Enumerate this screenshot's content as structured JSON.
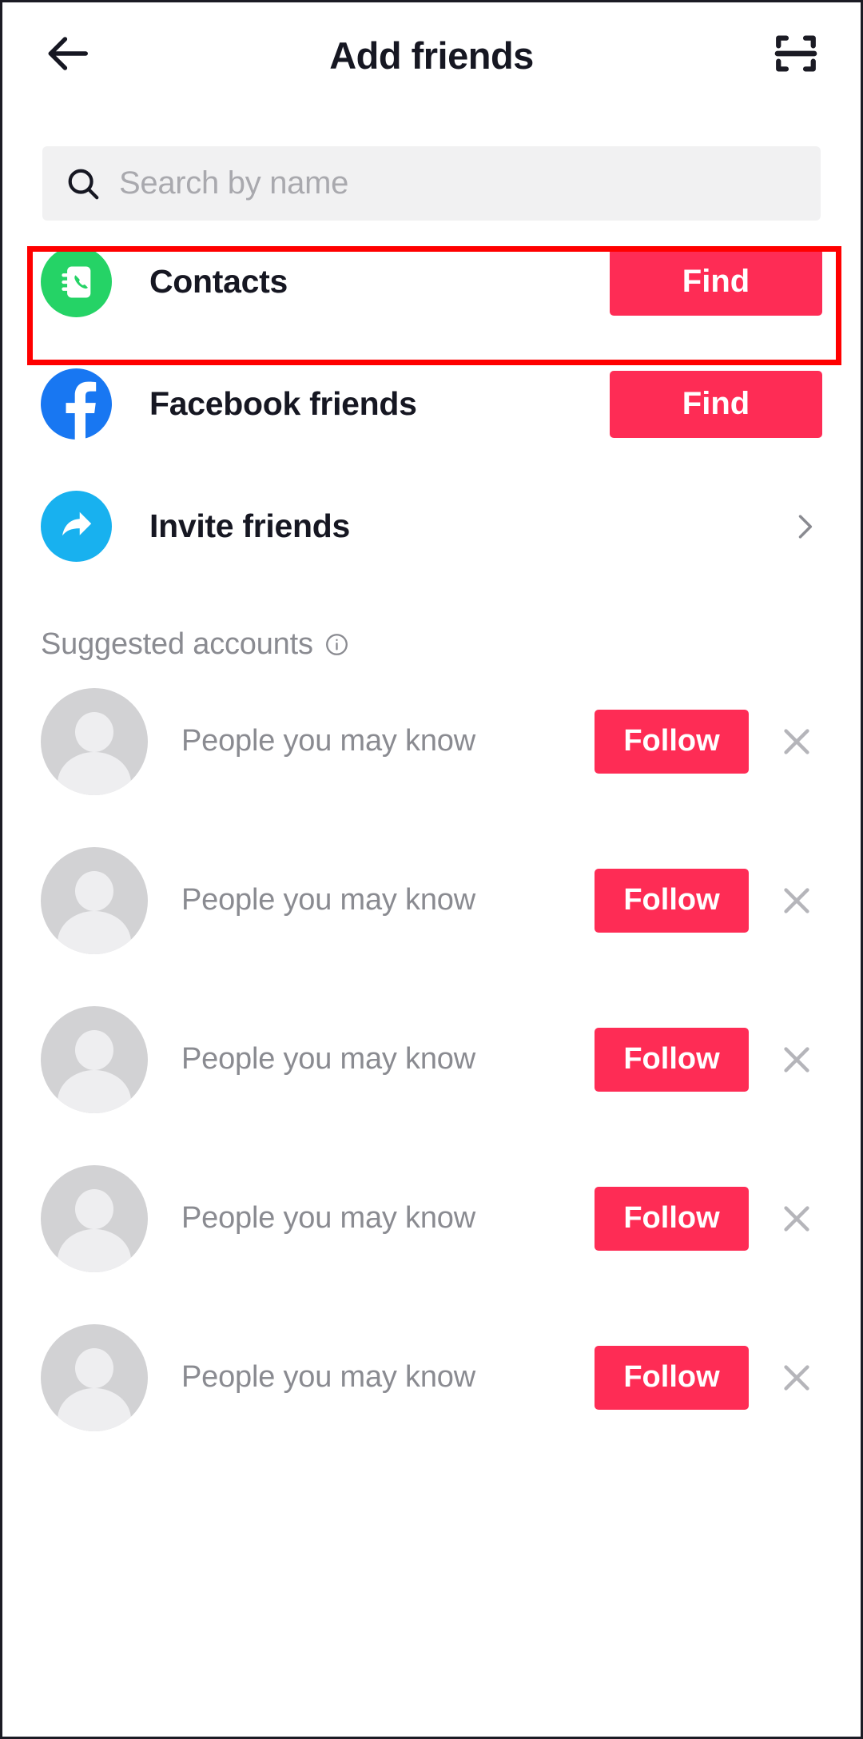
{
  "header": {
    "back_icon": "arrow-left-icon",
    "title": "Add friends",
    "scan_icon": "qr-scan-icon"
  },
  "search": {
    "icon": "search-icon",
    "placeholder": "Search by name",
    "value": ""
  },
  "sources": [
    {
      "id": "contacts",
      "label": "Contacts",
      "icon": "contacts-book-phone-icon",
      "icon_bg": "#25d366",
      "action_type": "button",
      "action_label": "Find",
      "highlighted": true
    },
    {
      "id": "facebook",
      "label": "Facebook friends",
      "icon": "facebook-icon",
      "icon_bg": "#1877f2",
      "action_type": "button",
      "action_label": "Find",
      "highlighted": false
    },
    {
      "id": "invite",
      "label": "Invite friends",
      "icon": "share-arrow-icon",
      "icon_bg": "#18b1ef",
      "action_type": "chevron",
      "action_label": "",
      "highlighted": false
    }
  ],
  "suggested": {
    "heading": "Suggested accounts",
    "info_icon": "info-circle-icon",
    "follow_label": "Follow",
    "dismiss_icon": "close-icon",
    "accounts": [
      {
        "name": "People you may know",
        "follow_label": "Follow"
      },
      {
        "name": "People you may know",
        "follow_label": "Follow"
      },
      {
        "name": "People you may know",
        "follow_label": "Follow"
      },
      {
        "name": "People you may know",
        "follow_label": "Follow"
      },
      {
        "name": "People you may know",
        "follow_label": "Follow"
      }
    ]
  },
  "colors": {
    "accent": "#fe2c55",
    "highlight_box": "#ff0000",
    "text_primary": "#161722",
    "text_muted": "#8a8b91",
    "search_bg": "#f1f1f2"
  }
}
